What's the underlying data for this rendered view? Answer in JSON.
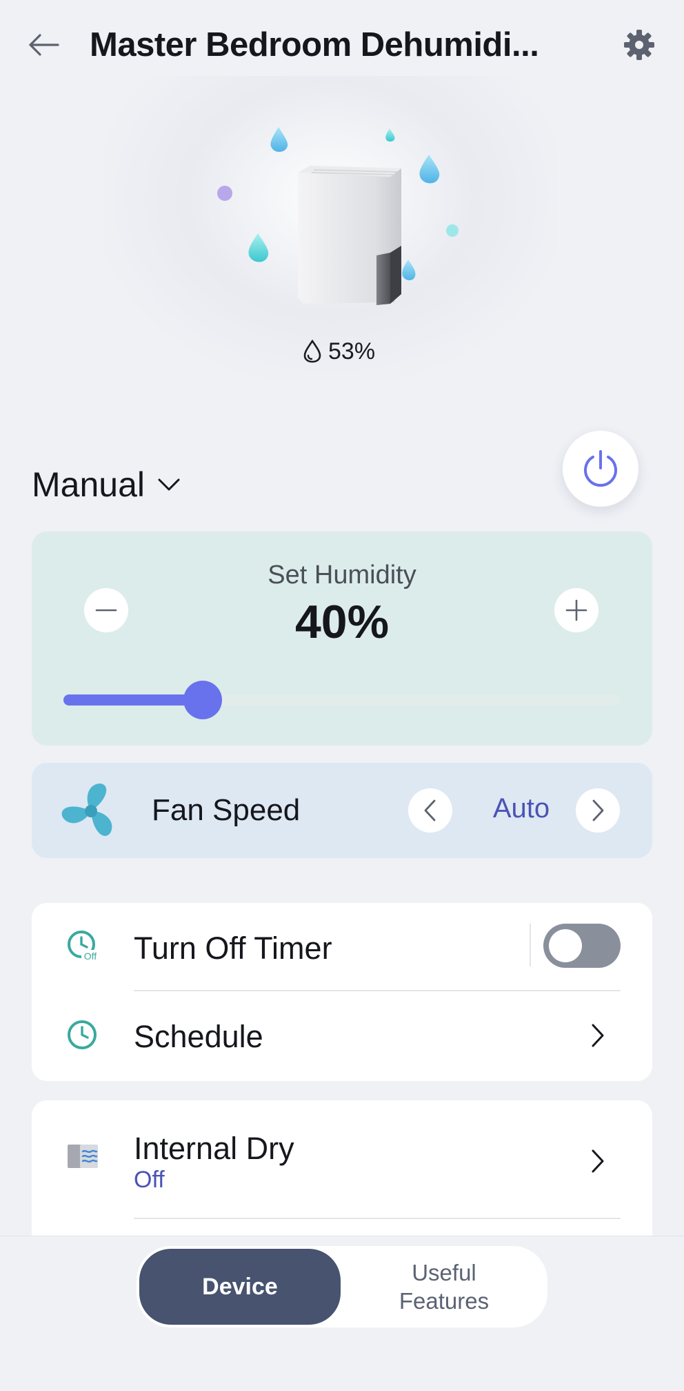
{
  "header": {
    "title": "Master Bedroom Dehumidi...",
    "back_icon": "arrow-left-icon",
    "settings_icon": "gear-icon"
  },
  "hero": {
    "current_humidity": "53%",
    "humidity_icon": "water-drop-icon"
  },
  "mode": {
    "label": "Manual",
    "dropdown_icon": "chevron-down-icon"
  },
  "power": {
    "icon": "power-icon",
    "accent": "#6872ec"
  },
  "set_humidity": {
    "label": "Set Humidity",
    "value": "40%",
    "slider_level": 0.25,
    "minus_icon": "minus-icon",
    "plus_icon": "plus-icon",
    "accent": "#6872ec"
  },
  "fan_speed": {
    "label": "Fan Speed",
    "value": "Auto",
    "icon": "fan-icon",
    "prev_icon": "chevron-left-icon",
    "next_icon": "chevron-right-icon"
  },
  "settings_list": {
    "turn_off_timer": {
      "label": "Turn Off Timer",
      "icon": "timer-off-icon",
      "enabled": false
    },
    "schedule": {
      "label": "Schedule",
      "icon": "clock-icon"
    },
    "internal_dry": {
      "label": "Internal Dry",
      "status": "Off",
      "icon": "internal-dry-icon"
    }
  },
  "tabs": {
    "device": "Device",
    "useful_features": "Useful\nFeatures",
    "selected": "Device"
  },
  "colors": {
    "background": "#eff1f5",
    "humidity_card": "#dcecea",
    "fan_card": "#dde8f3",
    "tab_selected": "#47536f",
    "link_text": "#4b53b3"
  }
}
